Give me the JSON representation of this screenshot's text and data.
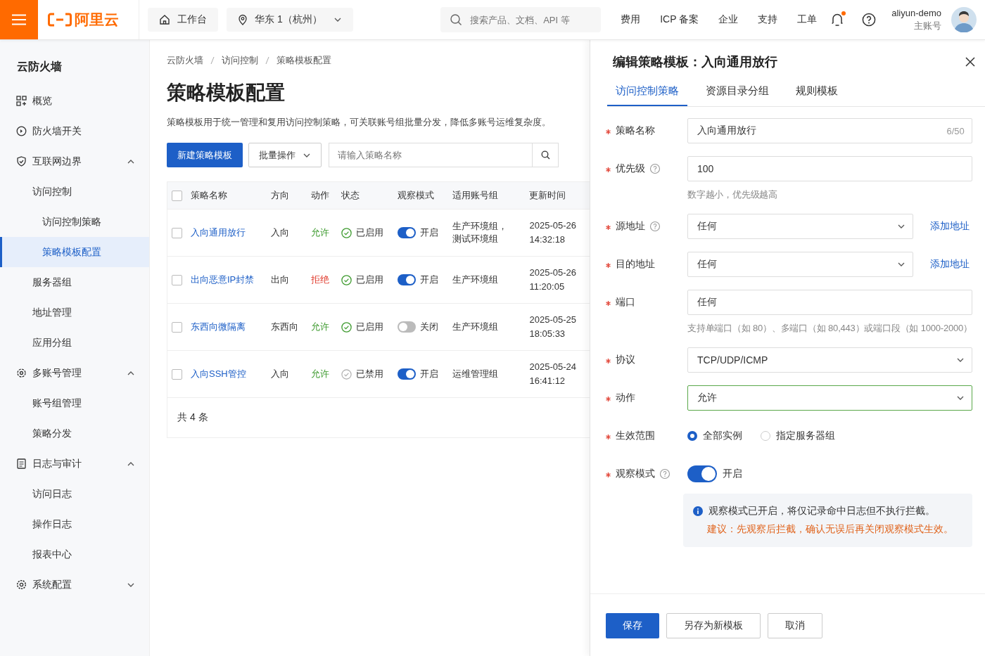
{
  "topbar": {
    "logo": "阿里云",
    "workbench": "工作台",
    "region": "华东 1（杭州）",
    "search": {
      "placeholder": "搜索产品、文档、API 等"
    },
    "nav": [
      "费用",
      "ICP 备案",
      "企业",
      "支持",
      "工单"
    ],
    "user": {
      "name": "aliyun-demo",
      "role": "主账号"
    }
  },
  "sidebar": {
    "title": "云防火墙",
    "items": [
      {
        "label": "概览",
        "selected": false
      },
      {
        "label": "防火墙开关",
        "selected": false
      },
      {
        "label": "互联网边界",
        "selected": false,
        "expanded": true,
        "children": [
          {
            "label": "访问控制",
            "selected": false,
            "children": [
              {
                "label": "访问控制策略",
                "selected": false
              },
              {
                "label": "策略模板配置",
                "selected": true
              }
            ]
          },
          {
            "label": "服务器组",
            "selected": false
          },
          {
            "label": "地址管理",
            "selected": false
          },
          {
            "label": "应用分组",
            "selected": false
          }
        ]
      },
      {
        "label": "多账号管理",
        "selected": false,
        "expanded": true,
        "children": [
          {
            "label": "账号组管理",
            "selected": false
          },
          {
            "label": "策略分发",
            "selected": false
          }
        ]
      },
      {
        "label": "日志与审计",
        "selected": false,
        "expanded": true,
        "children": [
          {
            "label": "访问日志",
            "selected": false
          },
          {
            "label": "操作日志",
            "selected": false
          },
          {
            "label": "报表中心",
            "selected": false
          }
        ]
      },
      {
        "label": "系统配置",
        "selected": false,
        "expanded": false
      }
    ]
  },
  "main": {
    "breadcrumb": [
      "云防火墙",
      "访问控制",
      "策略模板配置"
    ],
    "title": "策略模板配置",
    "description": "策略模板用于统一管理和复用访问控制策略，可关联账号组批量分发，降低多账号运维复杂度。",
    "new_button": "新建策略模板",
    "batch_button": "批量操作",
    "search": {
      "placeholder": "请输入策略名称"
    },
    "table": {
      "header_checked": false,
      "columns": [
        "策略名称",
        "方向",
        "动作",
        "状态",
        "观察模式",
        "适用账号组",
        "更新时间"
      ],
      "rows": [
        {
          "checked": false,
          "name": "入向通用放行",
          "direction": "入向",
          "action": {
            "text": "允许",
            "color": "#3d9a2e"
          },
          "status": {
            "text": "已启用",
            "enabled": true
          },
          "observe": {
            "on": true,
            "text": "开启"
          },
          "groups": "生产环境组，测试环境组",
          "updated": "2025-05-26 14:32:18"
        },
        {
          "checked": false,
          "name": "出向恶意IP封禁",
          "direction": "出向",
          "action": {
            "text": "拒绝",
            "color": "#e0392b"
          },
          "status": {
            "text": "已启用",
            "enabled": true
          },
          "observe": {
            "on": true,
            "text": "开启"
          },
          "groups": "生产环境组",
          "updated": "2025-05-26 11:20:05"
        },
        {
          "checked": false,
          "name": "东西向微隔离",
          "direction": "东西向",
          "action": {
            "text": "允许",
            "color": "#3d9a2e"
          },
          "status": {
            "text": "已启用",
            "enabled": true
          },
          "observe": {
            "on": false,
            "text": "关闭"
          },
          "groups": "生产环境组",
          "updated": "2025-05-25 18:05:33"
        },
        {
          "checked": false,
          "name": "入向SSH管控",
          "direction": "入向",
          "action": {
            "text": "允许",
            "color": "#3d9a2e"
          },
          "status": {
            "text": "已禁用",
            "enabled": false
          },
          "observe": {
            "on": true,
            "text": "开启"
          },
          "groups": "运维管理组",
          "updated": "2025-05-24 16:41:12"
        }
      ],
      "total": "共 4 条"
    }
  },
  "drawer": {
    "title": "编辑策略模板：入向通用放行",
    "tabs": [
      {
        "label": "访问控制策略",
        "selected": true
      },
      {
        "label": "资源目录分组",
        "selected": false
      },
      {
        "label": "规则模板",
        "selected": false
      }
    ],
    "fields": [
      {
        "kind": "text",
        "label": "策略名称",
        "required": true,
        "help": false,
        "value": "入向通用放行",
        "counter": "6/50"
      },
      {
        "kind": "text",
        "label": "优先级",
        "required": true,
        "help": true,
        "value": "100",
        "hint": "数字越小，优先级越高"
      },
      {
        "kind": "select",
        "label": "源地址",
        "required": true,
        "help": true,
        "value": "任何",
        "link": "添加地址"
      },
      {
        "kind": "select",
        "label": "目的地址",
        "required": true,
        "help": false,
        "value": "任何",
        "link": "添加地址"
      },
      {
        "kind": "text",
        "label": "端口",
        "required": true,
        "help": false,
        "value": "任何",
        "hint": "支持单端口（如 80）、多端口（如 80,443）或端口段（如 1000-2000）"
      },
      {
        "kind": "select",
        "label": "协议",
        "required": true,
        "help": false,
        "value": "TCP/UDP/ICMP"
      },
      {
        "kind": "select",
        "label": "动作",
        "required": true,
        "help": false,
        "value": "允许",
        "valid": true
      },
      {
        "kind": "radio",
        "label": "生效范围",
        "required": true,
        "help": false,
        "options": [
          {
            "label": "全部实例",
            "selected": true
          },
          {
            "label": "指定服务器组",
            "selected": false
          }
        ]
      },
      {
        "kind": "switch",
        "label": "观察模式",
        "required": true,
        "help": true,
        "on": true,
        "text": "开启",
        "notice": "观察模式已开启，将仅记录命中日志但不执行拦截。",
        "suggestion": "建议：先观察后拦截，确认无误后再关闭观察模式生效。"
      }
    ],
    "buttons": [
      {
        "label": "保存",
        "primary": true
      },
      {
        "label": "另存为新模板",
        "primary": false
      },
      {
        "label": "取消",
        "primary": false
      }
    ]
  }
}
